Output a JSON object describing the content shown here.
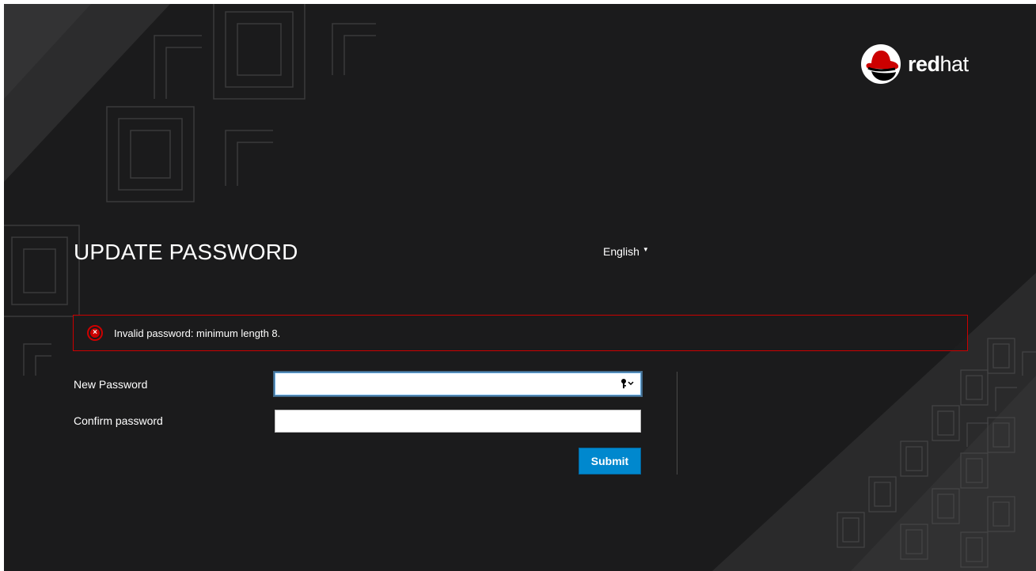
{
  "brand": {
    "name_bold": "red",
    "name_light": "hat",
    "icon": "redhat-logo-icon",
    "accent_color": "#cc0000"
  },
  "header": {
    "title": "UPDATE PASSWORD"
  },
  "language": {
    "selected": "English",
    "icon": "chevron-down-icon"
  },
  "alert": {
    "icon": "error-circle-icon",
    "message": "Invalid password: minimum length 8.",
    "color": "#cc0000"
  },
  "form": {
    "new_password": {
      "label": "New Password",
      "value": "",
      "icon": "password-key-icon"
    },
    "confirm_password": {
      "label": "Confirm password",
      "value": ""
    },
    "submit_label": "Submit",
    "submit_color": "#0088ce"
  }
}
